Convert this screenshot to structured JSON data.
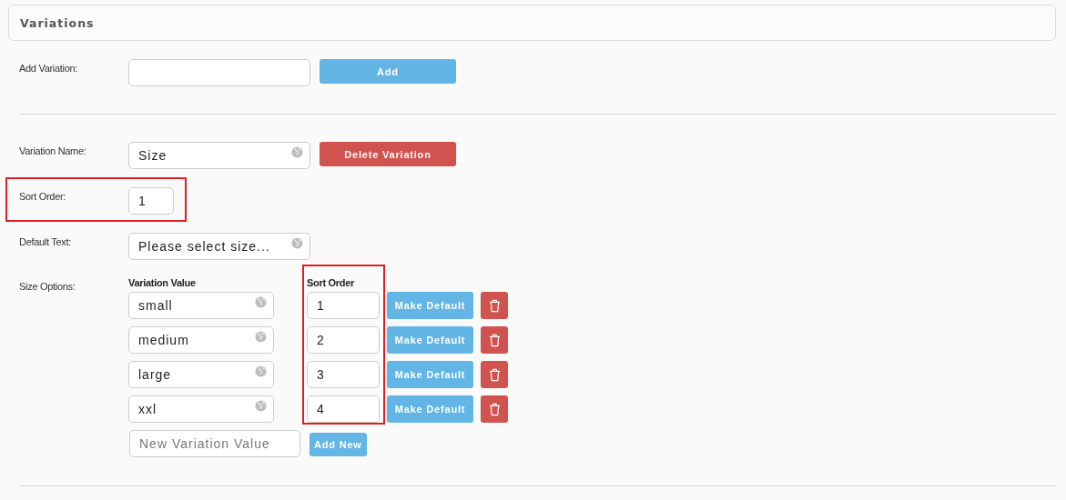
{
  "panel": {
    "title": "Variations"
  },
  "add_variation": {
    "label": "Add Variation:",
    "button": "Add"
  },
  "variation": {
    "name_label": "Variation Name:",
    "name": "Size",
    "delete_button": "Delete Variation",
    "sort_label": "Sort Order:",
    "sort_value": "1",
    "sort_highlighted": true,
    "default_label": "Default Text:",
    "default_text": "Please select size..."
  },
  "options": {
    "label": "Size Options:",
    "value_heading": "Variation Value",
    "sort_heading": "Sort Order",
    "sort_column_highlighted": true,
    "rows": [
      {
        "value": "small",
        "sort": "1",
        "button": "Make Default"
      },
      {
        "value": "medium",
        "sort": "2",
        "button": "Make Default"
      },
      {
        "value": "large",
        "sort": "3",
        "button": "Make Default"
      },
      {
        "value": "xxl",
        "sort": "4",
        "button": "Make Default"
      }
    ],
    "new_placeholder": "New Variation Value",
    "add_button": "Add New"
  }
}
